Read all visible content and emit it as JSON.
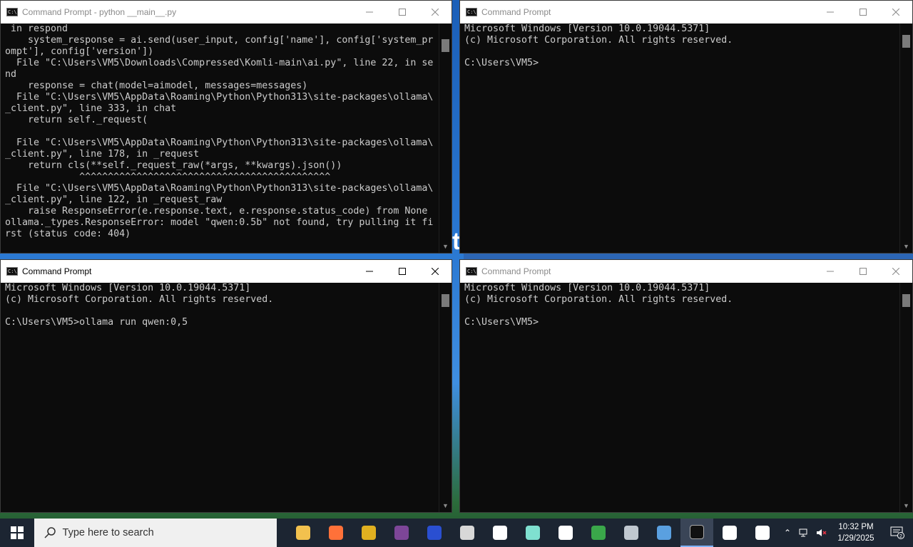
{
  "windows": {
    "top_left": {
      "title": "Command Prompt - python  __main__.py",
      "lines": [
        " in respond",
        "    system_response = ai.send(user_input, config['name'], config['system_pr",
        "ompt'], config['version'])",
        "  File \"C:\\Users\\VM5\\Downloads\\Compressed\\Komli-main\\ai.py\", line 22, in se",
        "nd",
        "    response = chat(model=aimodel, messages=messages)",
        "  File \"C:\\Users\\VM5\\AppData\\Roaming\\Python\\Python313\\site-packages\\ollama\\",
        "_client.py\", line 333, in chat",
        "    return self._request(",
        "",
        "  File \"C:\\Users\\VM5\\AppData\\Roaming\\Python\\Python313\\site-packages\\ollama\\",
        "_client.py\", line 178, in _request",
        "    return cls(**self._request_raw(*args, **kwargs).json())",
        "             ^^^^^^^^^^^^^^^^^^^^^^^^^^^^^^^^^^^^^^^^^^^^",
        "  File \"C:\\Users\\VM5\\AppData\\Roaming\\Python\\Python313\\site-packages\\ollama\\",
        "_client.py\", line 122, in _request_raw",
        "    raise ResponseError(e.response.text, e.response.status_code) from None",
        "ollama._types.ResponseError: model \"qwen:0.5b\" not found, try pulling it fi",
        "rst (status code: 404)"
      ]
    },
    "top_right": {
      "title": "Command Prompt",
      "lines": [
        "Microsoft Windows [Version 10.0.19044.5371]",
        "(c) Microsoft Corporation. All rights reserved.",
        "",
        "C:\\Users\\VM5>"
      ]
    },
    "bottom_left": {
      "title": "Command Prompt",
      "lines": [
        "Microsoft Windows [Version 10.0.19044.5371]",
        "(c) Microsoft Corporation. All rights reserved.",
        "",
        "C:\\Users\\VM5>ollama run qwen:0,5"
      ]
    },
    "bottom_right": {
      "title": "Command Prompt",
      "lines": [
        "Microsoft Windows [Version 10.0.19044.5371]",
        "(c) Microsoft Corporation. All rights reserved.",
        "",
        "C:\\Users\\VM5>"
      ]
    }
  },
  "desktop_char": "t",
  "taskbar": {
    "search_placeholder": "Type here to search",
    "apps": [
      {
        "name": "file-explorer-icon",
        "color": "#f2c14e"
      },
      {
        "name": "firefox-icon",
        "color": "#ff7139"
      },
      {
        "name": "app-yellow-icon",
        "color": "#e0b020"
      },
      {
        "name": "tor-browser-icon",
        "color": "#7d4698"
      },
      {
        "name": "app-blue-icon",
        "color": "#2a4fd1"
      },
      {
        "name": "roblox-icon",
        "color": "#d8d8d8"
      },
      {
        "name": "star-app-icon",
        "color": "#ffffff"
      },
      {
        "name": "gem-app-icon",
        "color": "#7fe0d0"
      },
      {
        "name": "7zip-icon",
        "color": "#ffffff"
      },
      {
        "name": "edge-legacy-icon",
        "color": "#3aa74a"
      },
      {
        "name": "drive-app-icon",
        "color": "#c0c8d0"
      },
      {
        "name": "control-panel-icon",
        "color": "#5aa0e0"
      },
      {
        "name": "command-prompt-icon",
        "color": "#111111"
      },
      {
        "name": "ollama-icon-1",
        "color": "#ffffff"
      },
      {
        "name": "ollama-icon-2",
        "color": "#ffffff"
      }
    ],
    "time": "10:32 PM",
    "date": "1/29/2025",
    "notification_count": "2"
  }
}
